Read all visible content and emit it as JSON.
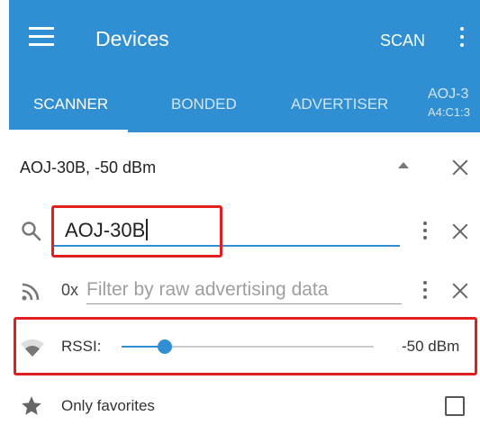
{
  "app_bar": {
    "title": "Devices",
    "scan_label": "SCAN"
  },
  "tabs": [
    {
      "label": "SCANNER",
      "active": true
    },
    {
      "label": "BONDED",
      "active": false
    },
    {
      "label": "ADVERTISER",
      "active": false
    },
    {
      "label": "AOJ-3",
      "sublabel": "A4:C1:3",
      "active": false
    }
  ],
  "filter": {
    "summary": "AOJ-30B, -50 dBm",
    "name_value": "AOJ-30B",
    "raw_prefix": "0x",
    "raw_placeholder": "Filter by raw advertising data",
    "rssi_label": "RSSI:",
    "rssi_value": "-50 dBm",
    "rssi_slider_fraction": 0.17,
    "favorites_label": "Only favorites",
    "favorites_checked": false
  },
  "colors": {
    "accent": "#2f8fd2",
    "highlight": "#e02020"
  },
  "icons": [
    "menu-icon",
    "overflow-menu-icon",
    "collapse-icon",
    "close-icon",
    "search-icon",
    "rss-icon",
    "wifi-icon",
    "star-icon"
  ]
}
